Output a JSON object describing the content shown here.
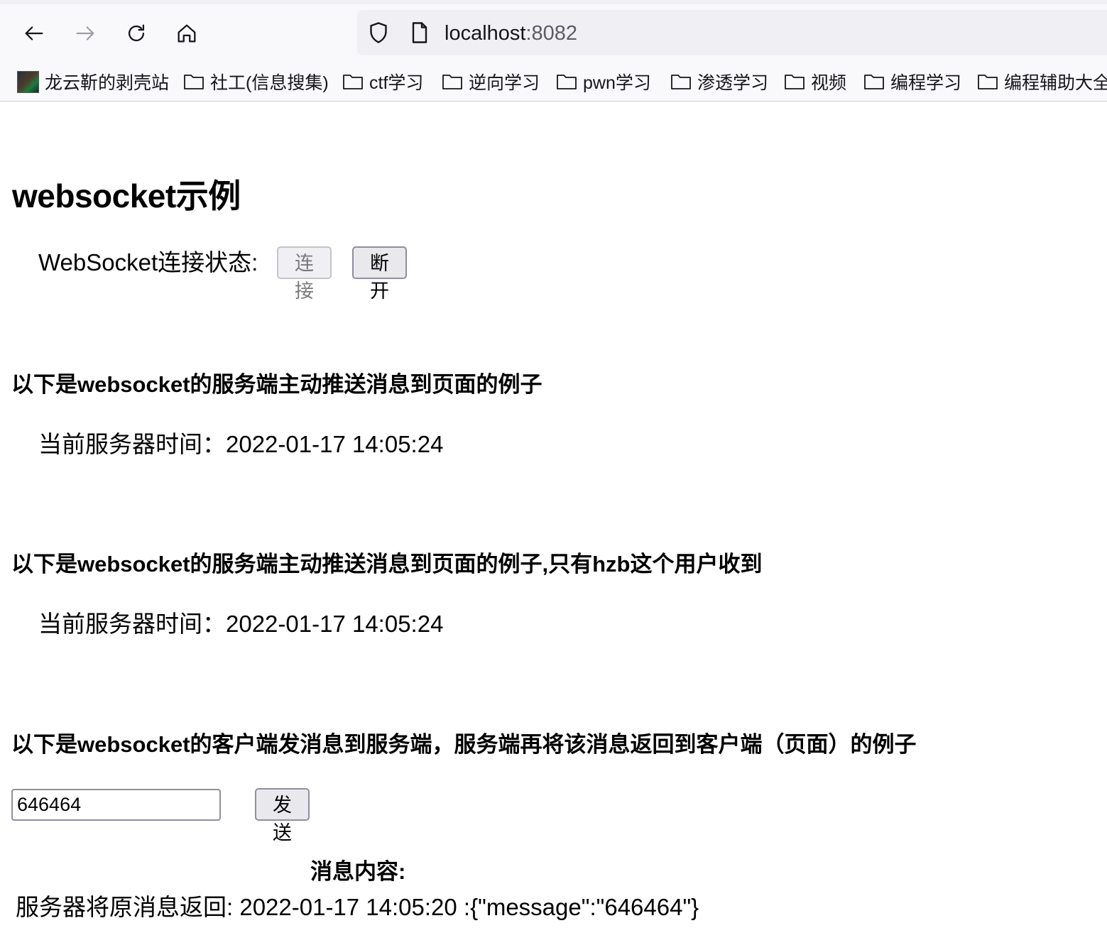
{
  "browser": {
    "url_host": "localhost",
    "url_port": ":8082",
    "bookmarks": [
      {
        "label": "龙云靳的剥壳站",
        "icon": "site-avatar-icon"
      },
      {
        "label": "社工(信息搜集)",
        "icon": "folder-icon"
      },
      {
        "label": "ctf学习",
        "icon": "folder-icon"
      },
      {
        "label": "逆向学习",
        "icon": "folder-icon"
      },
      {
        "label": "pwn学习",
        "icon": "folder-icon"
      },
      {
        "label": "渗透学习",
        "icon": "folder-icon"
      },
      {
        "label": "视频",
        "icon": "folder-icon"
      },
      {
        "label": "编程学习",
        "icon": "folder-icon"
      },
      {
        "label": "编程辅助大全",
        "icon": "folder-icon"
      }
    ]
  },
  "page": {
    "title": "websocket示例",
    "status_label": "WebSocket连接状态:",
    "connect_label": "连接",
    "disconnect_label": "断开",
    "section1_heading": "以下是websocket的服务端主动推送消息到页面的例子",
    "section1_time": "当前服务器时间：2022-01-17 14:05:24",
    "section2_heading": "以下是websocket的服务端主动推送消息到页面的例子,只有hzb这个用户收到",
    "section2_time": "当前服务器时间：2022-01-17 14:05:24",
    "section3_heading": "以下是websocket的客户端发消息到服务端，服务端再将该消息返回到客户端（页面）的例子",
    "input_value": "646464",
    "send_label": "发送",
    "message_title": "消息内容:",
    "message_body": "服务器将原消息返回: 2022-01-17 14:05:20 :{\"message\":\"646464\"}"
  }
}
